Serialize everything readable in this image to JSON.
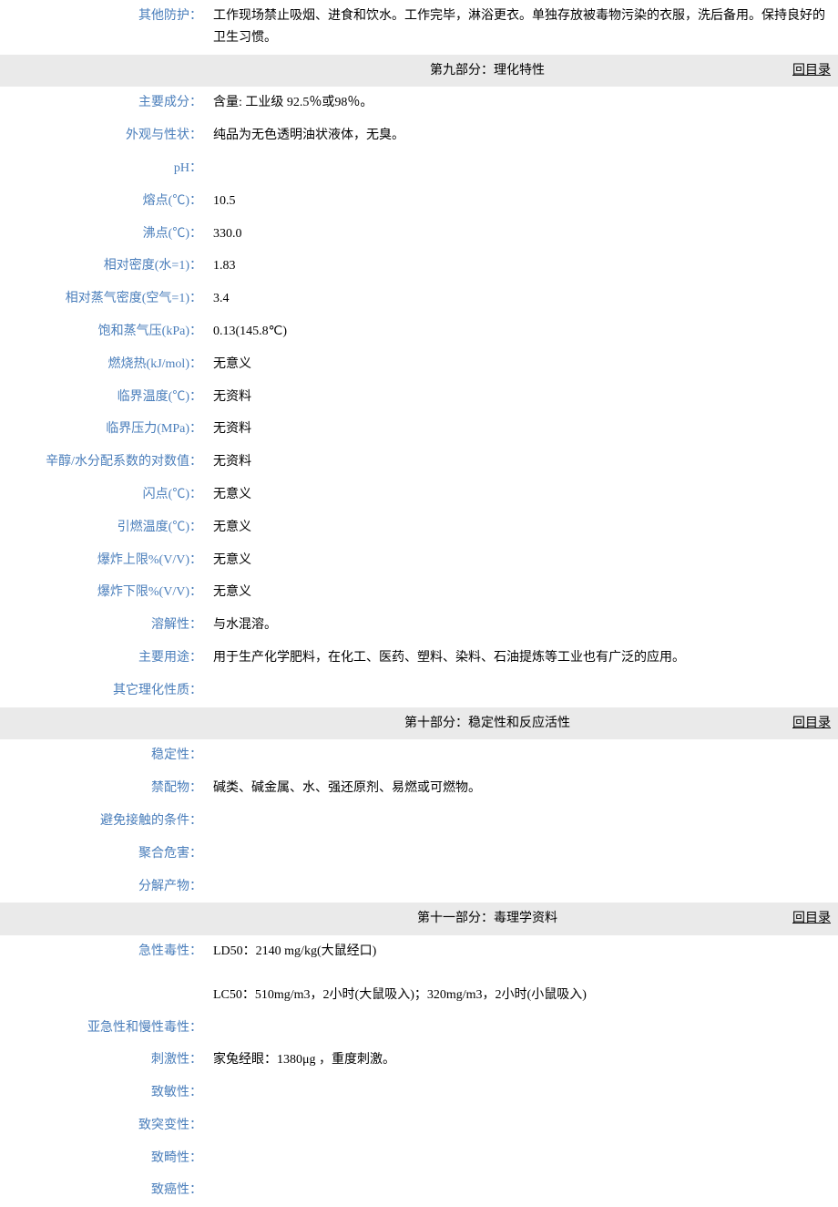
{
  "back_link": "回目录",
  "rows_top": [
    {
      "label": "其他防护：",
      "value": "工作现场禁止吸烟、进食和饮水。工作完毕，淋浴更衣。单独存放被毒物污染的衣服，洗后备用。保持良好的卫生习惯。"
    }
  ],
  "section9": {
    "title": "第九部分：理化特性",
    "rows": [
      {
        "label": "主要成分：",
        "value": "含量: 工业级 92.5％或98％。"
      },
      {
        "label": "外观与性状：",
        "value": "纯品为无色透明油状液体，无臭。"
      },
      {
        "label": "pH：",
        "value": ""
      },
      {
        "label": "熔点(℃)：",
        "value": "10.5"
      },
      {
        "label": "沸点(℃)：",
        "value": "330.0"
      },
      {
        "label": "相对密度(水=1)：",
        "value": "1.83"
      },
      {
        "label": "相对蒸气密度(空气=1)：",
        "value": "3.4"
      },
      {
        "label": "饱和蒸气压(kPa)：",
        "value": "0.13(145.8℃)"
      },
      {
        "label": "燃烧热(kJ/mol)：",
        "value": "无意义"
      },
      {
        "label": "临界温度(℃)：",
        "value": "无资料"
      },
      {
        "label": "临界压力(MPa)：",
        "value": "无资料"
      },
      {
        "label": "辛醇/水分配系数的对数值：",
        "value": "无资料"
      },
      {
        "label": "闪点(℃)：",
        "value": "无意义"
      },
      {
        "label": "引燃温度(℃)：",
        "value": "无意义"
      },
      {
        "label": "爆炸上限%(V/V)：",
        "value": "无意义"
      },
      {
        "label": "爆炸下限%(V/V)：",
        "value": "无意义"
      },
      {
        "label": "溶解性：",
        "value": "与水混溶。"
      },
      {
        "label": "主要用途：",
        "value": "用于生产化学肥料，在化工、医药、塑料、染料、石油提炼等工业也有广泛的应用。"
      },
      {
        "label": "其它理化性质：",
        "value": ""
      }
    ]
  },
  "section10": {
    "title": "第十部分：稳定性和反应活性",
    "rows": [
      {
        "label": "稳定性：",
        "value": ""
      },
      {
        "label": "禁配物：",
        "value": "碱类、碱金属、水、强还原剂、易燃或可燃物。"
      },
      {
        "label": "避免接触的条件：",
        "value": ""
      },
      {
        "label": "聚合危害：",
        "value": ""
      },
      {
        "label": "分解产物：",
        "value": ""
      }
    ]
  },
  "section11": {
    "title": "第十一部分：毒理学资料",
    "rows": [
      {
        "label": "急性毒性：",
        "value": "LD50：2140 mg/kg(大鼠经口)\n\nLC50：510mg/m3，2小时(大鼠吸入)；320mg/m3，2小时(小鼠吸入)"
      },
      {
        "label": "亚急性和慢性毒性：",
        "value": ""
      },
      {
        "label": "刺激性：",
        "value": "家兔经眼：1380μg ，重度刺激。"
      },
      {
        "label": "致敏性：",
        "value": ""
      },
      {
        "label": "致突变性：",
        "value": ""
      },
      {
        "label": "致畸性：",
        "value": ""
      },
      {
        "label": "致癌性：",
        "value": ""
      }
    ]
  }
}
